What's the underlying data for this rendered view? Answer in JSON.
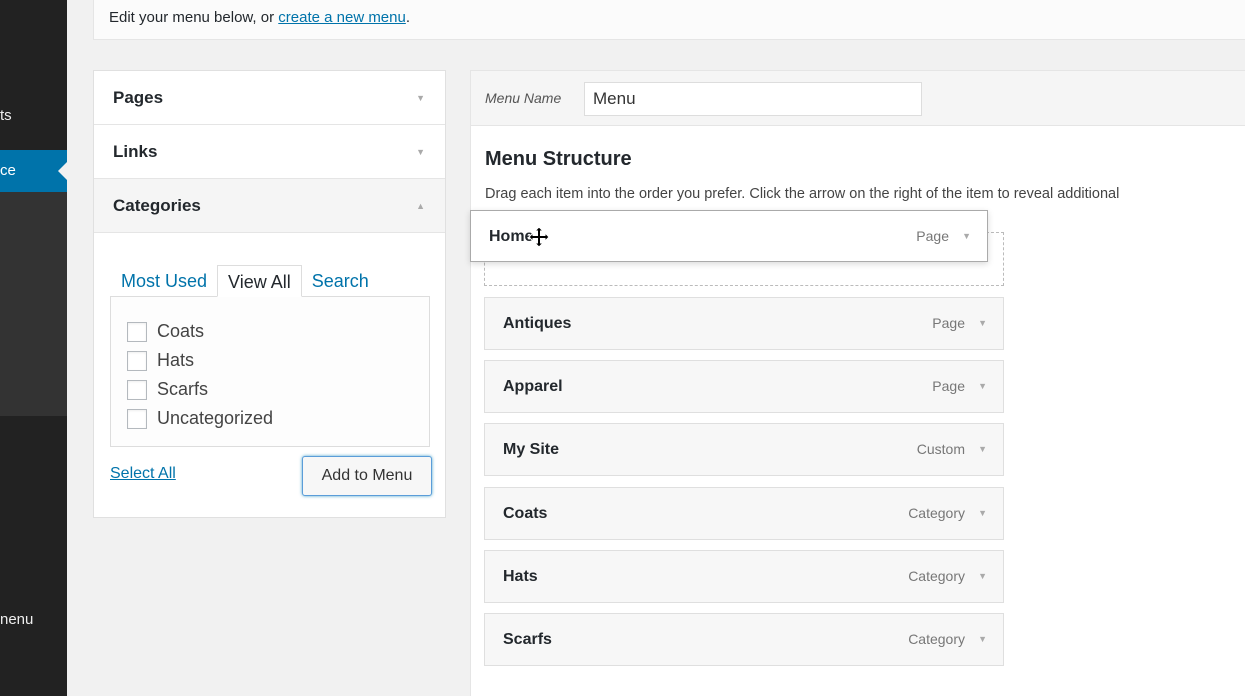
{
  "sidebar": {
    "items": [
      {
        "label": "ts"
      },
      {
        "label": "ce"
      },
      {
        "label": "nenu"
      }
    ]
  },
  "notice": {
    "prefix": "Edit your menu below, or ",
    "link": "create a new menu",
    "suffix": "."
  },
  "accordion": {
    "sections": [
      {
        "label": "Pages",
        "state": "collapsed"
      },
      {
        "label": "Links",
        "state": "collapsed"
      },
      {
        "label": "Categories",
        "state": "expanded"
      }
    ],
    "tabs": [
      {
        "label": "Most Used"
      },
      {
        "label": "View All",
        "active": true
      },
      {
        "label": "Search"
      }
    ],
    "categories": [
      {
        "label": "Coats",
        "checked": false
      },
      {
        "label": "Hats",
        "checked": false
      },
      {
        "label": "Scarfs",
        "checked": false
      },
      {
        "label": "Uncategorized",
        "checked": false
      }
    ],
    "select_all": "Select All",
    "add_button": "Add to Menu"
  },
  "manage": {
    "menu_name_label": "Menu Name",
    "menu_name_value": "Menu",
    "structure_title": "Menu Structure",
    "structure_desc": "Drag each item into the order you prefer. Click the arrow on the right of the item to reveal additional"
  },
  "menu_items": [
    {
      "title": "Home",
      "type": "Page",
      "dragging": true
    },
    {
      "title": "Antiques",
      "type": "Page"
    },
    {
      "title": "Apparel",
      "type": "Page"
    },
    {
      "title": "My Site",
      "type": "Custom"
    },
    {
      "title": "Coats",
      "type": "Category"
    },
    {
      "title": "Hats",
      "type": "Category"
    },
    {
      "title": "Scarfs",
      "type": "Category"
    }
  ],
  "colors": {
    "accent": "#0073aa",
    "sidebar_bg": "#222222",
    "page_bg": "#f1f1f1"
  }
}
